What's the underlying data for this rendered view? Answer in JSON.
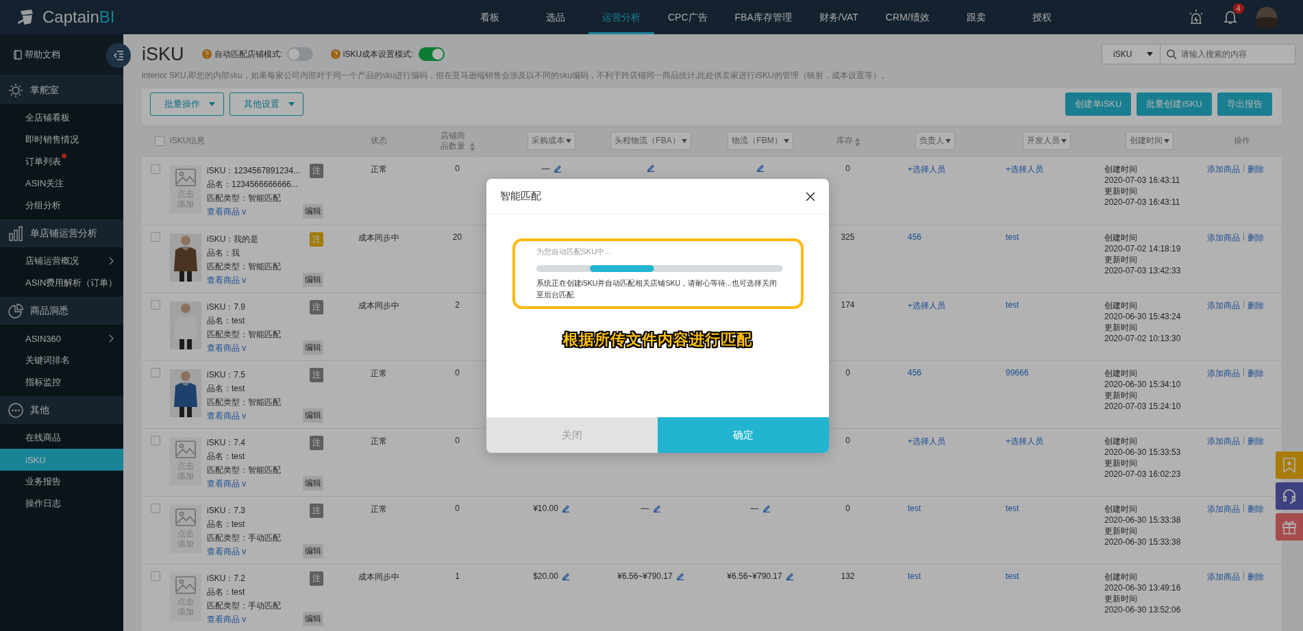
{
  "header": {
    "logo": {
      "text": "Captain",
      "accent": "BI"
    },
    "nav": [
      {
        "label": "看板",
        "selected": false
      },
      {
        "label": "选品",
        "selected": false
      },
      {
        "label": "运营分析",
        "selected": true
      },
      {
        "label": "CPC广告",
        "selected": false
      },
      {
        "label": "FBA库存管理",
        "selected": false
      },
      {
        "label": "财务/VAT",
        "selected": false
      },
      {
        "label": "CRM/绩效",
        "selected": false
      },
      {
        "label": "跟卖",
        "selected": false
      },
      {
        "label": "授权",
        "selected": false
      }
    ],
    "notification_count": "4"
  },
  "sidebar": {
    "help": "帮助文档",
    "sections": [
      {
        "title": "掌舵室",
        "items": [
          {
            "label": "全店铺看板",
            "selected": false
          },
          {
            "label": "即时销售情况",
            "selected": false
          },
          {
            "label": "订单列表",
            "selected": false,
            "dot": true
          },
          {
            "label": "ASIN关注",
            "selected": false
          },
          {
            "label": "分组分析",
            "selected": false
          }
        ]
      },
      {
        "title": "单店铺运营分析",
        "items": [
          {
            "label": "店铺运营概况",
            "selected": false,
            "chevron": true
          },
          {
            "label": "ASIN费用解析（订单）",
            "selected": false
          }
        ]
      },
      {
        "title": "商品洞悉",
        "items": [
          {
            "label": "ASIN360",
            "selected": false,
            "chevron": true
          },
          {
            "label": "关键词排名",
            "selected": false
          },
          {
            "label": "指标监控",
            "selected": false
          }
        ]
      },
      {
        "title": "其他",
        "items": [
          {
            "label": "在线商品",
            "selected": false
          },
          {
            "label": "iSKU",
            "selected": true
          },
          {
            "label": "业务报告",
            "selected": false
          },
          {
            "label": "操作日志",
            "selected": false
          }
        ]
      }
    ]
  },
  "page": {
    "title": "iSKU",
    "toggles": [
      {
        "label": "自动匹配店铺模式:",
        "on": false
      },
      {
        "label": "iSKU成本设置模式:",
        "on": true
      }
    ],
    "description": "interior SKU,即您的内部sku，如果每家公司内部对于同一个产品的sku进行编码，但在亚马逊端销售会涉及以不同的sku编码，不利于跨店铺同一商品统计,此处供卖家进行iSKU的管理（映射，成本设置等）。",
    "search": {
      "scope": "iSKU",
      "placeholder": "请输入搜索的内容"
    }
  },
  "toolbar": {
    "dropdowns": [
      "批量操作",
      "其他设置"
    ],
    "buttons": [
      "创建单iSKU",
      "批量创建iSKU",
      "导出报告"
    ]
  },
  "table": {
    "all_checked": false,
    "columns": [
      {
        "label": "iSKU信息",
        "kind": "plain"
      },
      {
        "label": "状态",
        "kind": "plain"
      },
      {
        "label": "店铺商品数量",
        "kind": "sort"
      },
      {
        "label": "采购成本",
        "kind": "filter"
      },
      {
        "label": "头程物流（FBA）",
        "kind": "filter"
      },
      {
        "label": "物流（FBM）",
        "kind": "filter"
      },
      {
        "label": "库存",
        "kind": "sort"
      },
      {
        "label": "负责人",
        "kind": "filter"
      },
      {
        "label": "开发人员",
        "kind": "filter"
      },
      {
        "label": "创建时间",
        "kind": "filter"
      },
      {
        "label": "操作",
        "kind": "plain"
      }
    ],
    "rows": [
      {
        "checked": false,
        "image": {
          "kind": "placeholder",
          "text": "点击添加"
        },
        "isku": "iSKU：1234567891234...",
        "name": "品名：1234566666666...",
        "match": "匹配类型：智能匹配",
        "view": "查看商品 v",
        "note": "注",
        "note_flag": false,
        "edit": "编辑",
        "status": "正常",
        "store_count": "0",
        "cost": "—",
        "cost_edit": true,
        "fba": null,
        "fba_edit": true,
        "fbm": null,
        "fbm_edit": true,
        "stock": "0",
        "owner": "+选择人员",
        "developer": "+选择人员",
        "created_label": "创建时间",
        "created": "2020-07-03 16:43:11",
        "updated_label": "更新时间",
        "updated": "2020-07-03 16:43:11",
        "actions": [
          "添加商品",
          "删除"
        ]
      },
      {
        "checked": false,
        "image": {
          "kind": "picture"
        },
        "isku": "iSKU：我的是",
        "name": "品名：我",
        "match": "匹配类型：智能匹配",
        "view": "查看商品 v",
        "note": "注",
        "note_flag": true,
        "edit": "编辑",
        "status": "成本同步中",
        "store_count": "20",
        "stock": "325",
        "owner": "456",
        "developer": "test",
        "created_label": "创建时间",
        "created": "2020-07-02 14:18:19",
        "updated_label": "更新时间",
        "updated": "2020-07-03 13:42:33",
        "actions": [
          "添加商品",
          "删除"
        ]
      },
      {
        "checked": false,
        "image": {
          "kind": "picture"
        },
        "isku": "iSKU：7.9",
        "name": "品名：test",
        "match": "匹配类型：智能匹配",
        "view": "查看商品 v",
        "note": "注",
        "note_flag": false,
        "edit": "编辑",
        "status": "成本同步中",
        "store_count": "2",
        "stock": "174",
        "owner": "+选择人员",
        "developer": "test",
        "created_label": "创建时间",
        "created": "2020-06-30 15:43:24",
        "updated_label": "更新时间",
        "updated": "2020-07-02 10:13:30",
        "actions": [
          "添加商品",
          "删除"
        ]
      },
      {
        "checked": false,
        "image": {
          "kind": "picture"
        },
        "isku": "iSKU：7.5",
        "name": "品名：test",
        "match": "匹配类型：智能匹配",
        "view": "查看商品 v",
        "note": "注",
        "note_flag": false,
        "edit": "编辑",
        "status": "正常",
        "store_count": "0",
        "stock": "0",
        "owner": "456",
        "developer": "99666",
        "created_label": "创建时间",
        "created": "2020-06-30 15:34:10",
        "updated_label": "更新时间",
        "updated": "2020-07-03 15:24:10",
        "actions": [
          "添加商品",
          "删除"
        ]
      },
      {
        "checked": false,
        "image": {
          "kind": "placeholder",
          "text": "点击添加"
        },
        "isku": "iSKU：7.4",
        "name": "品名：test",
        "match": "匹配类型：智能匹配",
        "view": "查看商品 v",
        "note": "注",
        "note_flag": false,
        "edit": "编辑",
        "status": "正常",
        "store_count": "0",
        "stock": "0",
        "owner": "+选择人员",
        "developer": "+选择人员",
        "created_label": "创建时间",
        "created": "2020-06-30 15:33:53",
        "updated_label": "更新时间",
        "updated": "2020-07-03 16:02:23",
        "actions": [
          "添加商品",
          "删除"
        ]
      },
      {
        "checked": false,
        "image": {
          "kind": "placeholder",
          "text": "点击添加"
        },
        "isku": "iSKU：7.3",
        "name": "品名：test",
        "match": "匹配类型：手动匹配",
        "view": "查看商品 v",
        "note": "注",
        "note_flag": false,
        "edit": "编辑",
        "status": "正常",
        "store_count": "0",
        "cost": "¥10.00",
        "cost_edit": true,
        "fba": "—",
        "fba_edit": true,
        "fbm": "—",
        "fbm_edit": true,
        "stock": "0",
        "owner": "test",
        "developer": "test",
        "created_label": "创建时间",
        "created": "2020-06-30 15:33:38",
        "updated_label": "更新时间",
        "updated": "2020-06-30 15:33:38",
        "actions": [
          "添加商品",
          "删除"
        ]
      },
      {
        "checked": false,
        "image": {
          "kind": "placeholder",
          "text": "点击添加"
        },
        "isku": "iSKU：7.2",
        "name": "品名：test",
        "match": "匹配类型：手动匹配",
        "view": "查看商品 v",
        "note": "注",
        "note_flag": false,
        "edit": "编辑",
        "status": "成本同步中",
        "store_count": "1",
        "cost": "$20.00",
        "cost_edit": true,
        "fba": "¥6.56~¥790.17",
        "fba_edit": true,
        "fbm": "¥6.56~¥790.17",
        "fbm_edit": true,
        "stock": "132",
        "owner": "test",
        "developer": "test",
        "created_label": "创建时间",
        "created": "2020-06-30 13:49:16",
        "updated_label": "更新时间",
        "updated": "2020-06-30 13:52:06",
        "actions": [
          "添加商品",
          "删除"
        ]
      }
    ]
  },
  "modal": {
    "title": "智能匹配",
    "progress_label": "为您自动匹配SKU中...",
    "level": 0.26,
    "message": "系统正在创建iSKU并自动匹配相关店铺SKU，请耐心等待...也可选择关闭至后台匹配",
    "caption": "根据所传文件内容进行匹配",
    "buttons": [
      {
        "label": "关闭",
        "disabled": true
      },
      {
        "label": "确定",
        "disabled": false
      }
    ]
  }
}
